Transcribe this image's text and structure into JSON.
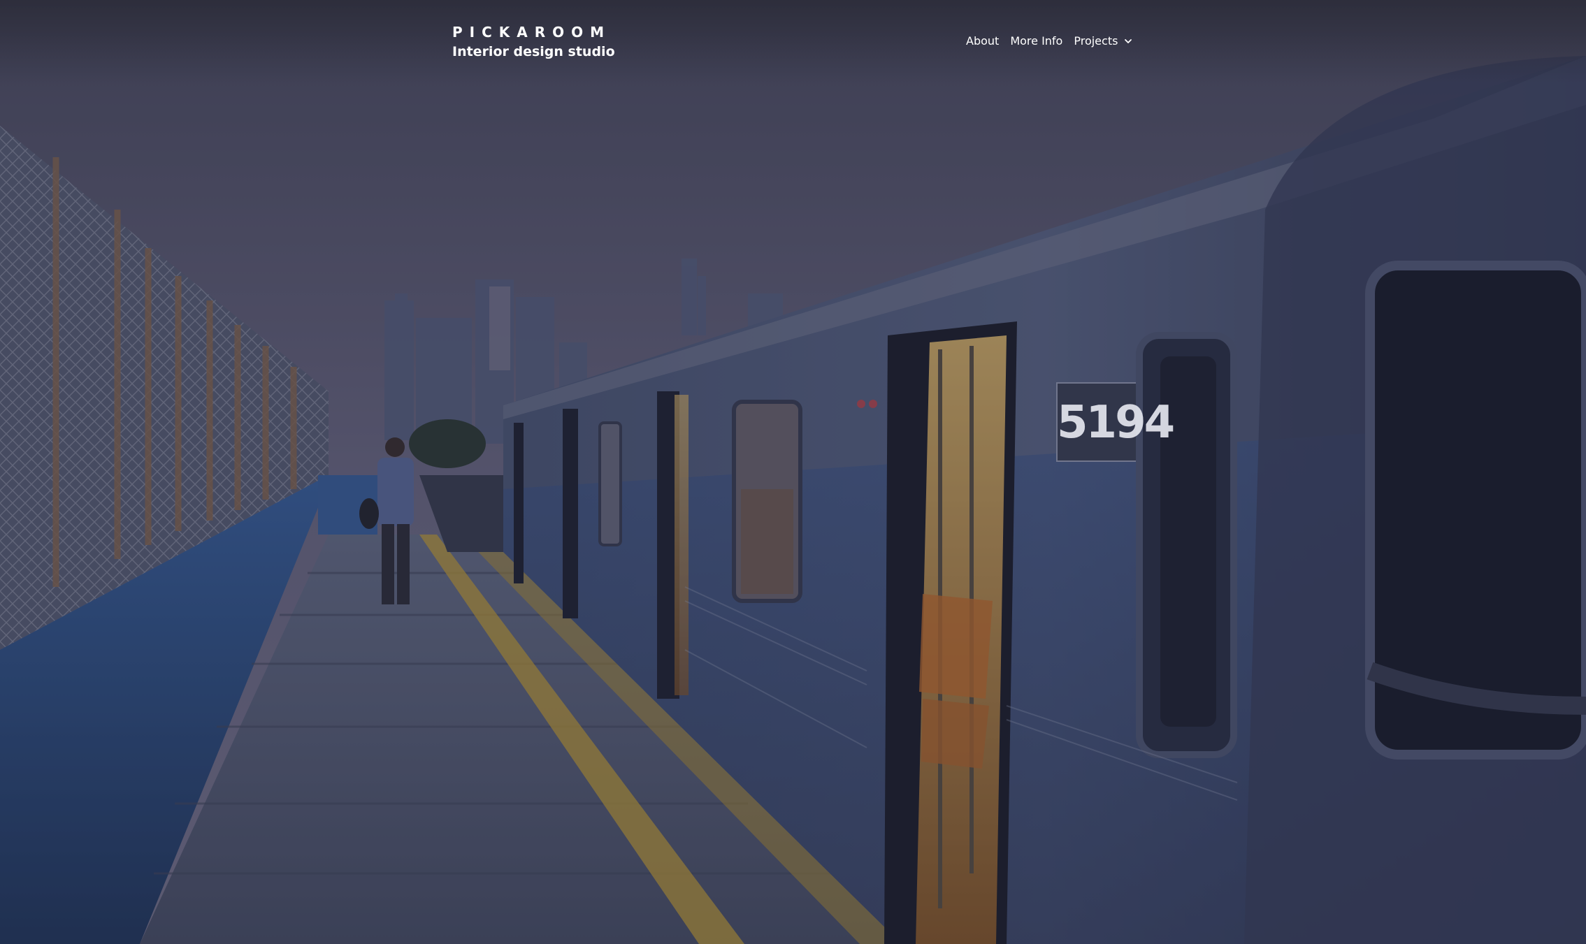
{
  "brand": {
    "name": "PICKAROOM",
    "tagline": "Interior design studio"
  },
  "nav": {
    "items": [
      {
        "label": "About"
      },
      {
        "label": "More Info"
      },
      {
        "label": "Projects",
        "icon": "chevron-down-icon",
        "has_dropdown": true
      }
    ]
  },
  "hero": {
    "train_car_number": "5194"
  },
  "colors": {
    "overlay": "#2b2e44",
    "sky": "#6a6a86",
    "platform_stripe": "#c9a43a",
    "wall_blue": "#2f5a96",
    "text": "#ffffff"
  }
}
